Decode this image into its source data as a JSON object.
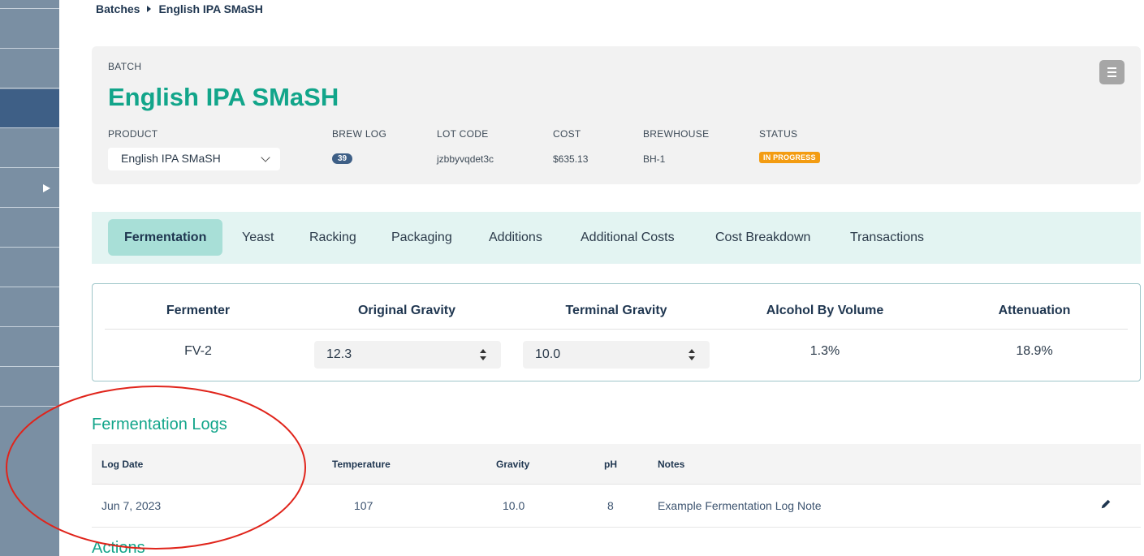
{
  "breadcrumb": {
    "parent": "Batches",
    "current": "English IPA SMaSH"
  },
  "batch": {
    "overline": "BATCH",
    "title": "English IPA SMaSH",
    "labels": {
      "product": "PRODUCT",
      "brew_log": "BREW LOG",
      "lot_code": "LOT CODE",
      "cost": "COST",
      "brewhouse": "BREWHOUSE",
      "status": "STATUS"
    },
    "product_value": "English IPA SMaSH",
    "brew_log_count": "39",
    "lot_code": "jzbbyvqdet3c",
    "cost": "$635.13",
    "brewhouse": "BH-1",
    "status": "IN PROGRESS"
  },
  "tabs": [
    {
      "label": "Fermentation",
      "active": true
    },
    {
      "label": "Yeast"
    },
    {
      "label": "Racking"
    },
    {
      "label": "Packaging"
    },
    {
      "label": "Additions"
    },
    {
      "label": "Additional Costs"
    },
    {
      "label": "Cost Breakdown"
    },
    {
      "label": "Transactions"
    }
  ],
  "gravity": {
    "headers": {
      "fermenter": "Fermenter",
      "og": "Original Gravity",
      "tg": "Terminal Gravity",
      "abv": "Alcohol By Volume",
      "attenuation": "Attenuation"
    },
    "fermenter": "FV-2",
    "og": "12.3",
    "tg": "10.0",
    "abv": "1.3%",
    "attenuation": "18.9%"
  },
  "logs": {
    "title": "Fermentation Logs",
    "columns": {
      "date": "Log Date",
      "temp": "Temperature",
      "gravity": "Gravity",
      "ph": "pH",
      "notes": "Notes"
    },
    "rows": [
      {
        "date": "Jun 7, 2023",
        "temp": "107",
        "gravity": "10.0",
        "ph": "8",
        "notes": "Example Fermentation Log Note"
      }
    ]
  },
  "actions_title": "Actions",
  "colors": {
    "accent": "#12a58a",
    "sidebar": "#7a8fa3",
    "sidebar_active": "#3e5f86",
    "status": "#f39c12",
    "annotation": "#e0241b"
  },
  "icons": [
    "menu-icon",
    "chevron-down-icon",
    "spinner-icon",
    "pencil-icon",
    "caret-right-icon"
  ]
}
